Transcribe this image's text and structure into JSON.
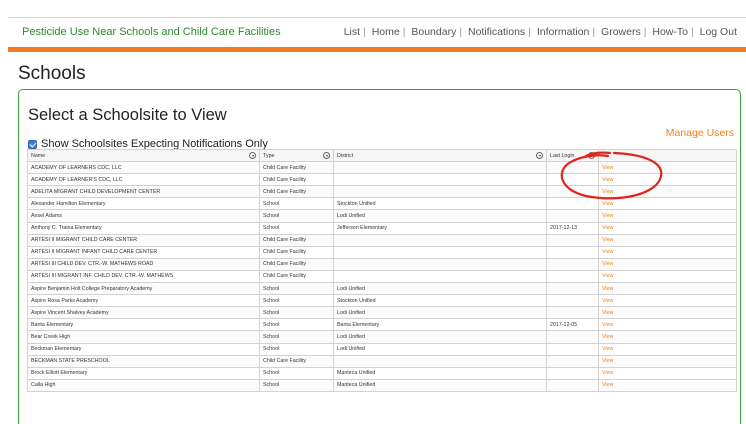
{
  "header": {
    "brand": "Pesticide Use Near Schools and Child Care Facilities",
    "nav": [
      "List",
      "Home",
      "Boundary",
      "Notifications",
      "Information",
      "Growers",
      "How-To",
      "Log Out"
    ],
    "accent_color": "#f27b22",
    "brand_color": "#2e8b2e"
  },
  "page": {
    "title": "Schools"
  },
  "panel": {
    "title": "Select a Schoolsite to View",
    "manage_users": "Manage Users",
    "filter_label": "Show Schoolsites Expecting Notifications Only",
    "filter_checked": true
  },
  "table": {
    "columns": [
      "Name",
      "Type",
      "District",
      "Last Login",
      ""
    ],
    "view_label": "View",
    "rows": [
      [
        "ACADEMY OF LEARNERS CDC, LLC",
        "Child Care Facility",
        "",
        ""
      ],
      [
        "ACADEMY OF LEARNER'S CDC, LLC",
        "Child Care Facility",
        "",
        ""
      ],
      [
        "ADELITA MIGRANT CHILD DEVELOPMENT CENTER",
        "Child Care Facility",
        "",
        ""
      ],
      [
        "Alexander Hamilton Elementary",
        "School",
        "Stockton Unified",
        ""
      ],
      [
        "Ansel Adams",
        "School",
        "Lodi Unified",
        ""
      ],
      [
        "Anthony C. Traina Elementary",
        "School",
        "Jefferson Elementary",
        "2017-12-13"
      ],
      [
        "ARTESI II MIGRANT CHILD CARE CENTER",
        "Child Care Facility",
        "",
        ""
      ],
      [
        "ARTESI II MIGRANT INFANT CHILD CARE CENTER",
        "Child Care Facility",
        "",
        ""
      ],
      [
        "ARTESI III CHILD DEV. CTR.-W. MATHEWS ROAD",
        "Child Care Facility",
        "",
        ""
      ],
      [
        "ARTESI III MIGRANT INF. CHILD DEV. CTR.-W. MATHEWS",
        "Child Care Facility",
        "",
        ""
      ],
      [
        "Aspire Benjamin Holt College Preparatory Academy",
        "School",
        "Lodi Unified",
        ""
      ],
      [
        "Aspire Rosa Parks Academy",
        "School",
        "Stockton Unified",
        ""
      ],
      [
        "Aspire Vincent Shalvey Academy",
        "School",
        "Lodi Unified",
        ""
      ],
      [
        "Banta Elementary",
        "School",
        "Banta Elementary",
        "2017-12-05"
      ],
      [
        "Bear Creek High",
        "School",
        "Lodi Unified",
        ""
      ],
      [
        "Beckman Elementary",
        "School",
        "Lodi Unified",
        ""
      ],
      [
        "BECKMAN STATE PRESCHOOL",
        "Child Care Facility",
        "",
        ""
      ],
      [
        "Brock Elliott Elementary",
        "School",
        "Manteca Unified",
        ""
      ],
      [
        "Calla High",
        "School",
        "Manteca Unified",
        ""
      ]
    ]
  }
}
